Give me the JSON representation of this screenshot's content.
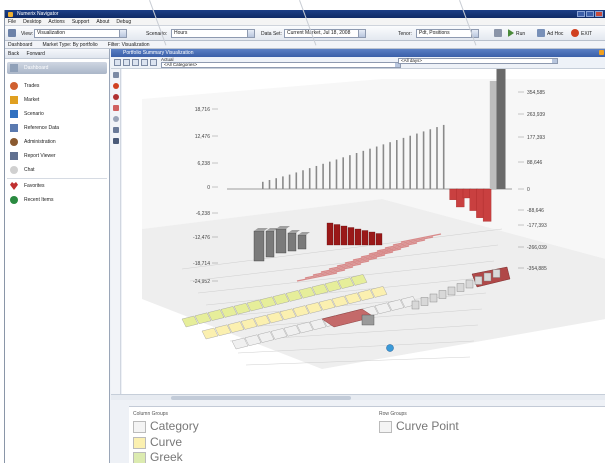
{
  "window": {
    "title": "Numerix Navigator",
    "colors": {
      "title_bar": "#173a80",
      "panel_header": "#4a6fb6",
      "accent_red": "#b02020",
      "positive_bars": "#9a9a9a"
    }
  },
  "menu": [
    "File",
    "Desktop",
    "Actions",
    "Support",
    "About",
    "Debug"
  ],
  "toolbar": {
    "view_label": "View:",
    "view_value": "Visualization",
    "scenario_label": "Scenario:",
    "scenario_value": "Hours",
    "dataset_label": "Data Set:",
    "dataset_value": "Current Market, Jul 18, 2008",
    "tenorset_label": "Tenor:",
    "tenorset_value": "Pdt, Positions",
    "run_label": "Run",
    "adhoc_label": "Ad Hoc",
    "exit_label": "EXIT"
  },
  "tabs": [
    "Dashboard",
    "Market Type: By portfolio",
    "Filter: Visualization"
  ],
  "sidebar": {
    "back_label": "Back",
    "forward_label": "Forward",
    "items": [
      {
        "label": "Dashboard",
        "icon": "dashboard-icon",
        "color": "#8fa0b8"
      },
      {
        "label": "Trades",
        "icon": "trades-icon",
        "color": "#d06030"
      },
      {
        "label": "Market",
        "icon": "market-icon",
        "color": "#e0a020"
      },
      {
        "label": "Scenario",
        "icon": "scenario-icon",
        "color": "#3070c0"
      },
      {
        "label": "Reference Data",
        "icon": "reference-data-icon",
        "color": "#5a7ab0"
      },
      {
        "label": "Administration",
        "icon": "administration-icon",
        "color": "#8a5a30"
      },
      {
        "label": "Report Viewer",
        "icon": "report-viewer-icon",
        "color": "#607090"
      },
      {
        "label": "Chat",
        "icon": "chat-icon",
        "color": "#d0d0d0"
      },
      {
        "label": "Favorites",
        "icon": "favorites-icon",
        "color": "#c03030"
      },
      {
        "label": "Recent Items",
        "icon": "recent-items-icon",
        "color": "#2a8a40"
      }
    ]
  },
  "panel": {
    "title": "Portfolio Summary Visualization",
    "actual_label": "Actual",
    "categories_value": "<All Categories>",
    "days_value": "<All days>"
  },
  "legend": {
    "column_groups_title": "Column Groups",
    "row_groups_title": "Row Groups",
    "column_groups": [
      {
        "label": "Category",
        "color": "#f4f4f4"
      },
      {
        "label": "Curve",
        "color": "#fbf0b0"
      },
      {
        "label": "Greek",
        "color": "#dcebb0"
      }
    ],
    "row_groups": [
      {
        "label": "Curve Point",
        "color": "#f4f4f4"
      }
    ]
  },
  "chart_data": {
    "type": "bar",
    "left_axis_ticks": [
      "18,716",
      "12,476",
      "6,238",
      "0",
      "-6,238",
      "-12,476",
      "-18,714",
      "-24,952"
    ],
    "right_axis_ticks": [
      "354,585",
      "263,939",
      "177,393",
      "88,646",
      "0",
      "-88,646",
      "-177,393",
      "-266,039",
      "-354,885"
    ],
    "values": [
      2,
      2.5,
      3,
      3.5,
      4,
      4.6,
      5.2,
      5.8,
      6.4,
      7,
      7.6,
      8.2,
      8.8,
      9.4,
      10,
      10.6,
      11.2,
      11.8,
      12.4,
      13,
      13.6,
      14.2,
      14.8,
      15.4,
      16,
      16.6,
      17.2,
      17.8,
      -3,
      -5,
      -2.5,
      -6,
      -8,
      -9,
      30,
      42
    ]
  }
}
